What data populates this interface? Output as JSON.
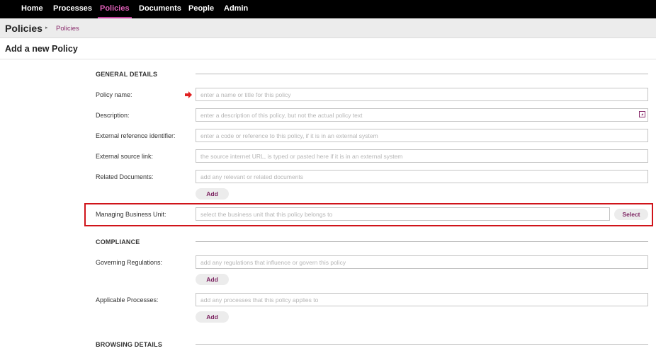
{
  "nav": {
    "items": [
      {
        "label": "Home"
      },
      {
        "label": "Processes"
      },
      {
        "label": "Policies"
      },
      {
        "label": "Documents"
      },
      {
        "label": "People"
      },
      {
        "label": "Admin"
      }
    ],
    "active": "Policies"
  },
  "header": {
    "title": "Policies",
    "breadcrumb_separator": "▸",
    "breadcrumb": "Policies"
  },
  "page": {
    "subtitle": "Add a new Policy"
  },
  "general": {
    "title": "GENERAL DETAILS",
    "policy_name": {
      "label": "Policy name:",
      "placeholder": "enter a name or title for this policy"
    },
    "description": {
      "label": "Description:",
      "placeholder": "enter a description of this policy, but not the actual policy text"
    },
    "external_ref": {
      "label": "External reference identifier:",
      "placeholder": "enter a code or reference to this policy, if it is in an external system"
    },
    "external_link": {
      "label": "External source link:",
      "placeholder": "the source internet URL, is typed or pasted here if it is in an external system"
    },
    "related_docs": {
      "label": "Related Documents:",
      "placeholder": "add any relevant or related documents",
      "button": "Add"
    },
    "business_unit": {
      "label": "Managing Business Unit:",
      "placeholder": "select the business unit that this policy belongs to",
      "button": "Select"
    }
  },
  "compliance": {
    "title": "COMPLIANCE",
    "regulations": {
      "label": "Governing Regulations:",
      "placeholder": "add any regulations that influence or govern this policy",
      "button": "Add"
    },
    "processes": {
      "label": "Applicable Processes:",
      "placeholder": "add any processes that this policy applies to",
      "button": "Add"
    }
  },
  "browsing": {
    "title": "BROWSING DETAILS"
  },
  "colors": {
    "accent": "#8a2d6d",
    "nav_active": "#e05fb9",
    "highlight": "#d0141a",
    "required": "#e02020"
  },
  "icons": {
    "required": "right-arrow-icon",
    "expand": "expand-icon"
  }
}
